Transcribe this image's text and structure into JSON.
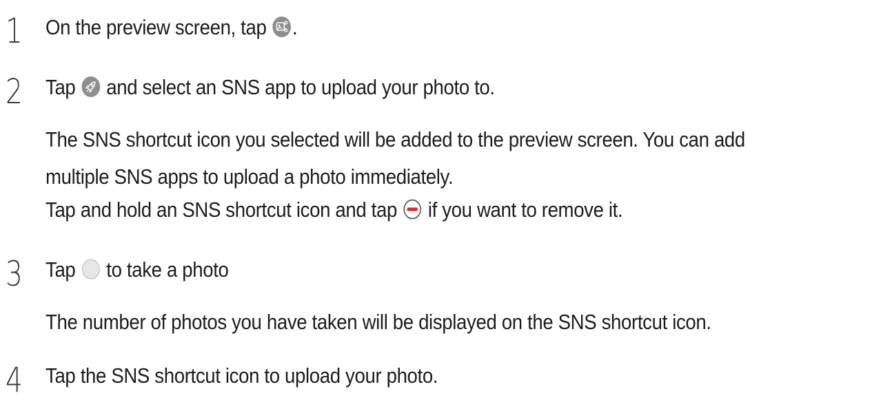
{
  "steps": [
    {
      "number": "1",
      "line1_before": "On the preview screen, tap ",
      "line1_icon": "share-shortcut-icon",
      "line1_after": "."
    },
    {
      "number": "2",
      "line1_before": "Tap ",
      "line1_icon": "rocket-icon",
      "line1_after": " and select an SNS app to upload your photo to.",
      "para1": "The SNS shortcut icon you selected will be added to the preview screen. You can add",
      "para2": "multiple SNS apps to upload a photo immediately.",
      "para3_before": "Tap and hold an SNS shortcut icon and tap ",
      "para3_icon": "remove-minus-icon",
      "para3_after": " if you want to remove it."
    },
    {
      "number": "3",
      "line1_before": "Tap ",
      "line1_icon": "shutter-circle-icon",
      "line1_after": " to take a photo",
      "para1": "The number of photos you have taken will be displayed on the SNS shortcut icon."
    },
    {
      "number": "4",
      "line1": "Tap the SNS shortcut icon to upload your photo."
    }
  ],
  "colors": {
    "icon_gray": "#8e8e8e",
    "remove_red": "#d8262e",
    "shutter_gray": "#e6e6e6"
  }
}
